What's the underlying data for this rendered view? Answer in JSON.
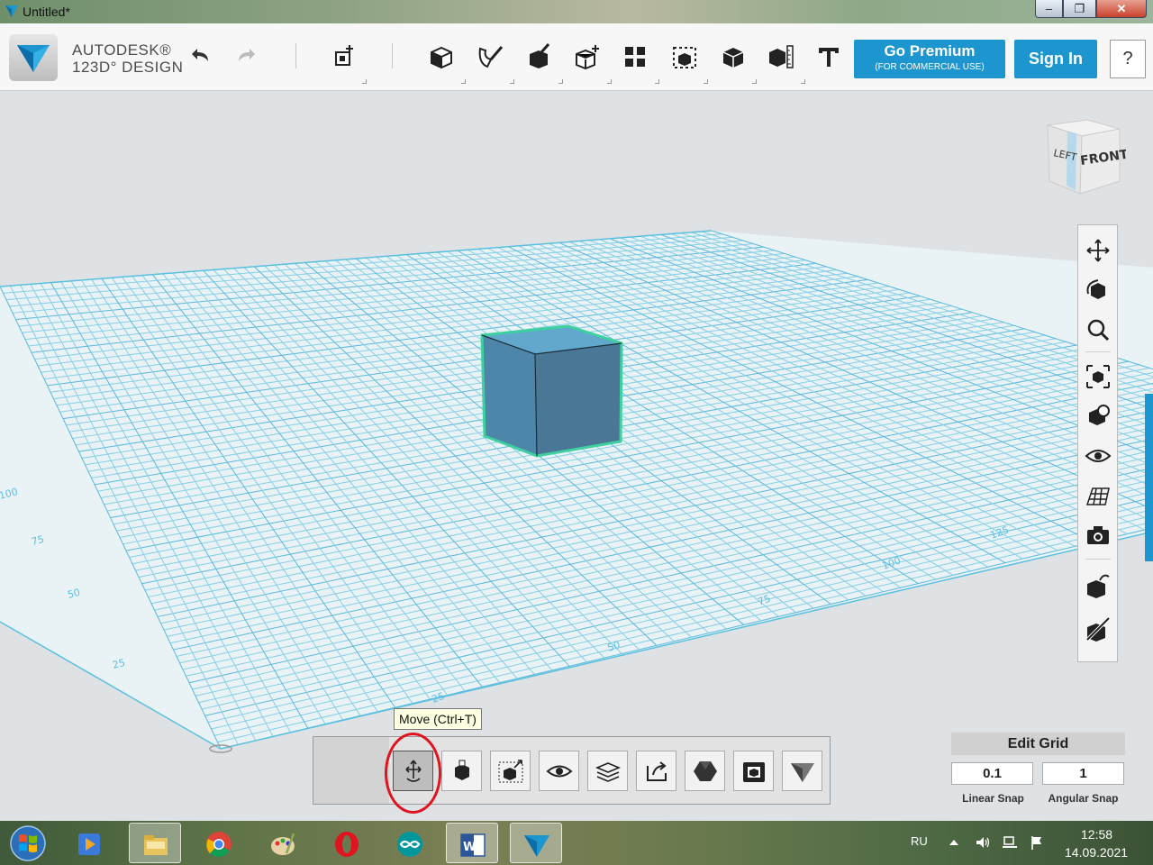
{
  "window": {
    "title": "Untitled*",
    "controls": {
      "minimize": "–",
      "maximize": "❐",
      "close": "✕"
    }
  },
  "brand": {
    "line1": "AUTODESK®",
    "line2": "123D° DESIGN"
  },
  "toolbar": {
    "items": [
      {
        "name": "undo-icon"
      },
      {
        "name": "redo-icon"
      },
      {
        "name": "primitives-icon"
      },
      {
        "name": "sketch-icon"
      },
      {
        "name": "construct-icon"
      },
      {
        "name": "modify-icon"
      },
      {
        "name": "pattern-icon"
      },
      {
        "name": "grouping-icon"
      },
      {
        "name": "combine-icon"
      },
      {
        "name": "measure-icon"
      },
      {
        "name": "materials-icon"
      },
      {
        "name": "text-icon"
      }
    ],
    "go_premium": "Go Premium",
    "go_premium_sub": "(FOR COMMERCIAL USE)",
    "sign_in": "Sign In",
    "help": "?"
  },
  "viewcube": {
    "left": "LEFT",
    "front": "FRONT"
  },
  "grid_labels": {
    "left_axis": [
      "25",
      "50",
      "75",
      "100"
    ],
    "front_axis": [
      "25",
      "50",
      "75",
      "100",
      "125"
    ]
  },
  "nav_panel": [
    "pan-icon",
    "orbit-icon",
    "zoom-icon",
    "fit-icon",
    "view-selection-icon",
    "visibility-icon",
    "grid-icon",
    "screenshot-icon",
    "material-icon",
    "show-hide-icon"
  ],
  "bottom_bar": {
    "tooltip": "Move (Ctrl+T)",
    "buttons": [
      "move-icon",
      "scale-icon",
      "smart-scale-icon",
      "visibility-icon",
      "layers-icon",
      "export-icon",
      "solid-icon",
      "snapshot-icon",
      "app-logo-icon"
    ]
  },
  "edit_grid": {
    "title": "Edit Grid",
    "linear_snap_value": "0.1",
    "angular_snap_value": "1",
    "linear_snap_label": "Linear Snap",
    "angular_snap_label": "Angular Snap"
  },
  "taskbar": {
    "apps": [
      "media-player-icon",
      "file-explorer-icon",
      "chrome-icon",
      "paint-icon",
      "opera-icon",
      "arduino-icon",
      "word-icon",
      "123d-design-icon"
    ],
    "language": "RU",
    "time": "12:58",
    "date": "14.09.2021"
  },
  "colors": {
    "accent": "#1d95cf",
    "grid": "#5bc0e0",
    "cube": "#4e7e9c",
    "selection": "#3fd0a0"
  }
}
